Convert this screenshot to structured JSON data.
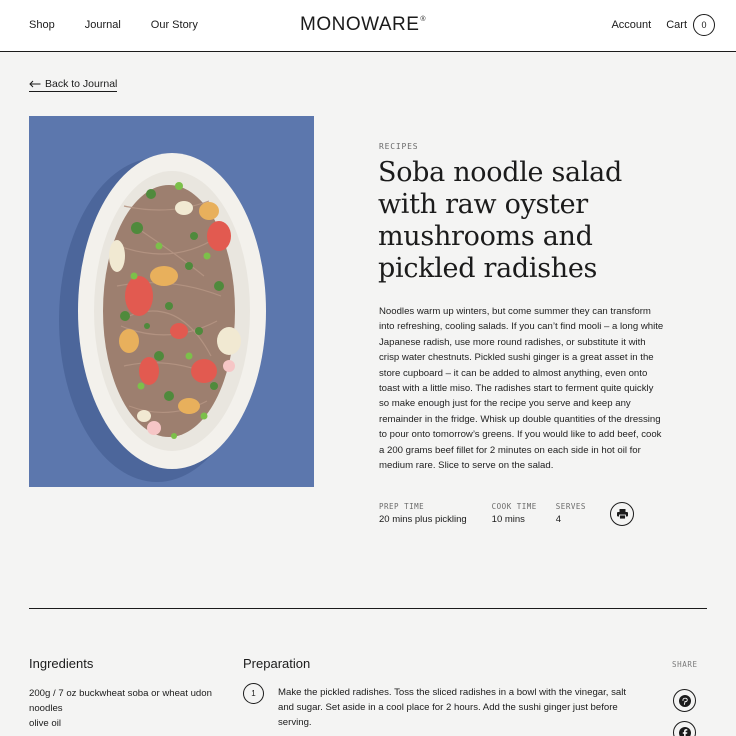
{
  "header": {
    "nav_left": [
      "Shop",
      "Journal",
      "Our Story"
    ],
    "logo": "MONOWARE",
    "logo_mark": "®",
    "account": "Account",
    "cart": "Cart",
    "cart_count": "0"
  },
  "back_link": "Back to Journal",
  "hero_image": {
    "icon": "soba-noodle-salad-plate-photo",
    "background": "#5b76ac"
  },
  "article": {
    "eyebrow": "RECIPES",
    "title": "Soba noodle salad with raw oyster mushrooms and pickled radishes",
    "description": "Noodles warm up winters, but come summer they can transform into refreshing, cooling salads. If you can’t find mooli – a long white Japanese radish, use more round radishes, or substitute it with crisp water chestnuts. Pickled sushi ginger is a great asset in the store cupboard – it can be added to almost anything, even onto toast with a little miso. The radishes start to ferment quite quickly so make enough just for the recipe you serve and keep any remainder in the fridge. Whisk up double quantities of the dressing to pour onto tomorrow’s greens. If you would like to add beef, cook a 200 grams beef fillet for 2 minutes on each side in hot oil for medium rare. Slice to serve on the salad."
  },
  "meta": {
    "prep_label": "PREP TIME",
    "prep_value": "20 mins plus pickling",
    "cook_label": "COOK TIME",
    "cook_value": "10 mins",
    "serves_label": "SERVES",
    "serves_value": "4",
    "print_icon": "printer-icon"
  },
  "ingredients": {
    "heading": "Ingredients",
    "items": [
      "200g / 7 oz buckwheat soba or wheat udon noodles",
      "olive oil"
    ]
  },
  "preparation": {
    "heading": "Preparation",
    "steps": [
      {
        "number": "1",
        "text": "Make the pickled radishes. Toss the sliced radishes in a bowl with the vinegar, salt and sugar. Set aside in a cool place for 2 hours. Add the sushi ginger just before serving."
      }
    ]
  },
  "share": {
    "label": "SHARE",
    "icons": [
      "pinterest-icon",
      "facebook-icon"
    ]
  }
}
